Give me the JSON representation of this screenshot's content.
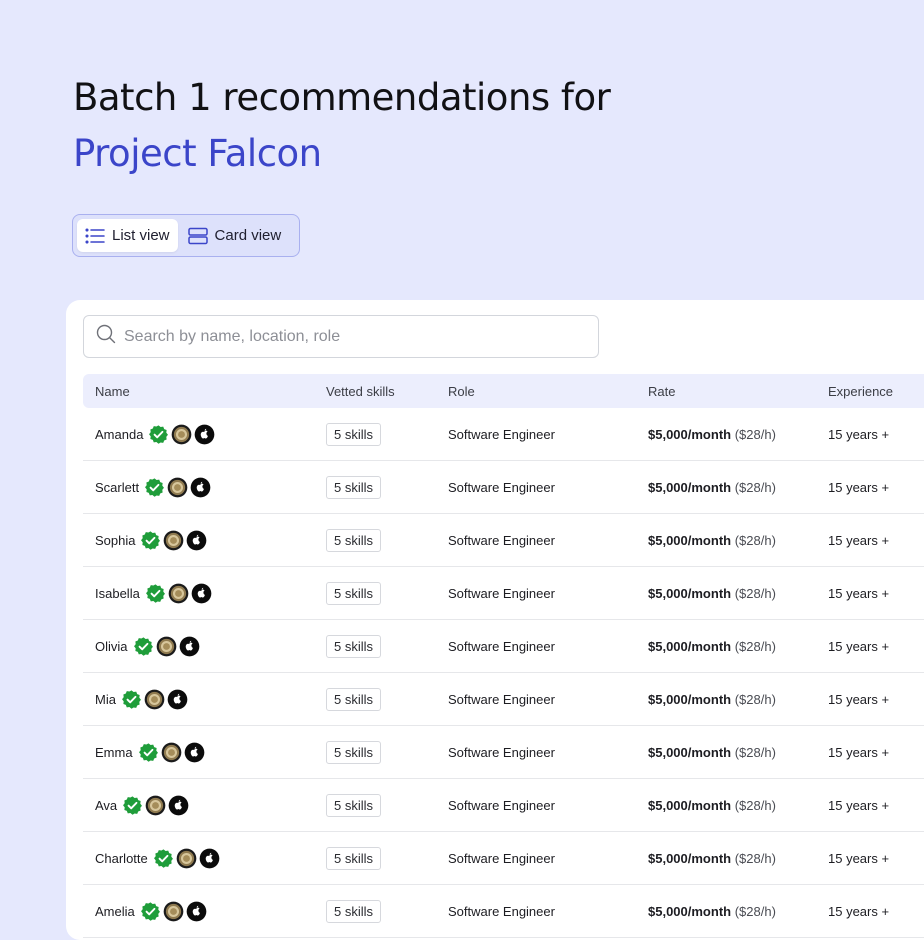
{
  "header": {
    "title_line1": "Batch 1 recommendations for",
    "title_line2": "Project Falcon",
    "accent_color": "#3b45c9"
  },
  "view_toggle": {
    "list_label": "List view",
    "card_label": "Card view",
    "active": "list"
  },
  "search": {
    "placeholder": "Search by name, location, role",
    "value": ""
  },
  "table": {
    "columns": [
      "Name",
      "Vetted skills",
      "Role",
      "Rate",
      "Experience"
    ],
    "badges": [
      "verified-check-icon",
      "gold-medal-icon",
      "apple-icon"
    ],
    "rows": [
      {
        "name": "Amanda",
        "skills": "5 skills",
        "role": "Software Engineer",
        "rate": "$5,000/month",
        "rate_hourly": "($28/h)",
        "experience": "15 years +"
      },
      {
        "name": "Scarlett",
        "skills": "5 skills",
        "role": "Software Engineer",
        "rate": "$5,000/month",
        "rate_hourly": "($28/h)",
        "experience": "15 years +"
      },
      {
        "name": "Sophia",
        "skills": "5 skills",
        "role": "Software Engineer",
        "rate": "$5,000/month",
        "rate_hourly": "($28/h)",
        "experience": "15 years +"
      },
      {
        "name": "Isabella",
        "skills": "5 skills",
        "role": "Software Engineer",
        "rate": "$5,000/month",
        "rate_hourly": "($28/h)",
        "experience": "15 years +"
      },
      {
        "name": "Olivia",
        "skills": "5 skills",
        "role": "Software Engineer",
        "rate": "$5,000/month",
        "rate_hourly": "($28/h)",
        "experience": "15 years +"
      },
      {
        "name": "Mia",
        "skills": "5 skills",
        "role": "Software Engineer",
        "rate": "$5,000/month",
        "rate_hourly": "($28/h)",
        "experience": "15 years +"
      },
      {
        "name": "Emma",
        "skills": "5 skills",
        "role": "Software Engineer",
        "rate": "$5,000/month",
        "rate_hourly": "($28/h)",
        "experience": "15 years +"
      },
      {
        "name": "Ava",
        "skills": "5 skills",
        "role": "Software Engineer",
        "rate": "$5,000/month",
        "rate_hourly": "($28/h)",
        "experience": "15 years +"
      },
      {
        "name": "Charlotte",
        "skills": "5 skills",
        "role": "Software Engineer",
        "rate": "$5,000/month",
        "rate_hourly": "($28/h)",
        "experience": "15 years +"
      },
      {
        "name": "Amelia",
        "skills": "5 skills",
        "role": "Software Engineer",
        "rate": "$5,000/month",
        "rate_hourly": "($28/h)",
        "experience": "15 years +"
      }
    ]
  }
}
